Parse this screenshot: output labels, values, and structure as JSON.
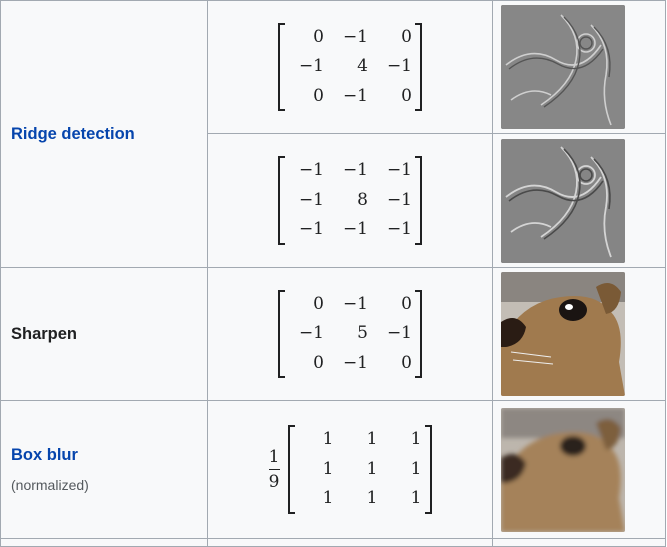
{
  "rows": [
    {
      "operation": "Ridge detection",
      "is_link": true,
      "subtitle": "",
      "kernels": [
        {
          "factor": null,
          "matrix": [
            [
              "0",
              "−1",
              "0"
            ],
            [
              "−1",
              "4",
              "−1"
            ],
            [
              "0",
              "−1",
              "0"
            ]
          ],
          "result_image": "ridge-detection-result-image-1"
        },
        {
          "factor": null,
          "matrix": [
            [
              "−1",
              "−1",
              "−1"
            ],
            [
              "−1",
              "8",
              "−1"
            ],
            [
              "−1",
              "−1",
              "−1"
            ]
          ],
          "result_image": "ridge-detection-result-image-2"
        }
      ]
    },
    {
      "operation": "Sharpen",
      "is_link": false,
      "subtitle": "",
      "kernels": [
        {
          "factor": null,
          "matrix": [
            [
              "0",
              "−1",
              "0"
            ],
            [
              "−1",
              "5",
              "−1"
            ],
            [
              "0",
              "−1",
              "0"
            ]
          ],
          "result_image": "sharpen-result-image"
        }
      ]
    },
    {
      "operation": "Box blur",
      "is_link": true,
      "subtitle": "(normalized)",
      "kernels": [
        {
          "factor": {
            "numerator": "1",
            "denominator": "9"
          },
          "matrix": [
            [
              "1",
              "1",
              "1"
            ],
            [
              "1",
              "1",
              "1"
            ],
            [
              "1",
              "1",
              "1"
            ]
          ],
          "result_image": "box-blur-result-image"
        }
      ]
    }
  ],
  "colors": {
    "link": "#0645ad",
    "text": "#202122",
    "border": "#a2a9b1",
    "cell_background": "#f8f9fa"
  }
}
